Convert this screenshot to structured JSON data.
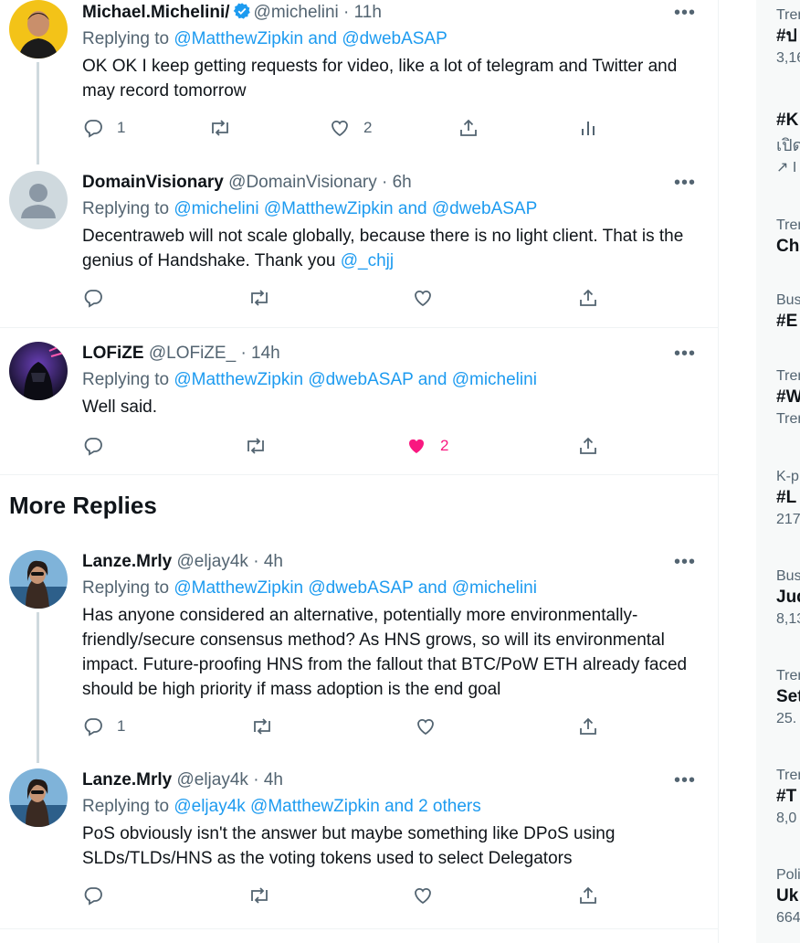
{
  "colors": {
    "accent": "#1d9bf0",
    "like": "#f91880",
    "muted": "#536471"
  },
  "tweets": [
    {
      "name": "Michael.Michelini/",
      "verified": true,
      "handle": "@michelini",
      "time": "11h",
      "reply_prefix": "Replying to",
      "mentions": "@MatthewZipkin and @dwebASAP",
      "text": "OK OK I keep getting requests for video, like a lot of telegram and Twitter and may record tomorrow",
      "reply_count": "1",
      "retweet_count": "",
      "like_count": "2",
      "liked": false
    },
    {
      "name": "DomainVisionary",
      "verified": false,
      "handle": "@DomainVisionary",
      "time": "6h",
      "reply_prefix": "Replying to",
      "mentions": "@michelini @MatthewZipkin and @dwebASAP",
      "text": "Decentraweb will not scale globally, because there is no light client.  That is the genius of Handshake.  Thank you",
      "text_mention": "@_chjj",
      "reply_count": "",
      "retweet_count": "",
      "like_count": "",
      "liked": false
    },
    {
      "name": "LOFiZE",
      "verified": false,
      "handle": "@LOFiZE_",
      "time": "14h",
      "reply_prefix": "Replying to",
      "mentions": "@MatthewZipkin @dwebASAP and @michelini",
      "text": "Well said.",
      "reply_count": "",
      "retweet_count": "",
      "like_count": "2",
      "liked": true
    },
    {
      "name": "Lanze.Mrly",
      "verified": false,
      "handle": "@eljay4k",
      "time": "4h",
      "reply_prefix": "Replying to",
      "mentions": "@MatthewZipkin @dwebASAP and @michelini",
      "text": "Has anyone considered an alternative, potentially more environmentally-friendly/secure consensus method? As HNS grows, so will its environmental impact. Future-proofing HNS from the fallout that BTC/PoW ETH already faced should be high priority if mass adoption is the end goal",
      "reply_count": "1",
      "retweet_count": "",
      "like_count": "",
      "liked": false
    },
    {
      "name": "Lanze.Mrly",
      "verified": false,
      "handle": "@eljay4k",
      "time": "4h",
      "reply_prefix": "Replying to",
      "mentions": "@eljay4k @MatthewZipkin and 2 others",
      "text": "PoS obviously isn't the answer but maybe something like DPoS using SLDs/TLDs/HNS as the voting tokens used to select Delegators",
      "reply_count": "",
      "retweet_count": "",
      "like_count": "",
      "liked": false
    }
  ],
  "more_replies_title": "More Replies",
  "dot": "·",
  "more_glyph": "•••",
  "trends": [
    {
      "meta": "Tren",
      "topic": "#ป",
      "count": "3,16"
    },
    {
      "meta": "",
      "topic": "#K",
      "count": "เปิด",
      "extra": "↗ I"
    },
    {
      "meta": "Tren",
      "topic": "Ch",
      "count": ""
    },
    {
      "meta": "Bus",
      "topic": "#E",
      "count": ""
    },
    {
      "meta": "Tren",
      "topic": "#W",
      "count": "Tren"
    },
    {
      "meta": "K-p",
      "topic": "#L",
      "count": "217"
    },
    {
      "meta": "Bus",
      "topic": "Jud",
      "count": "8,13"
    },
    {
      "meta": "Tren",
      "topic": "Set",
      "count": "25."
    },
    {
      "meta": "Tren",
      "topic": "#T",
      "count": "8,0"
    },
    {
      "meta": "Poli",
      "topic": "Uk",
      "count": "664"
    }
  ]
}
